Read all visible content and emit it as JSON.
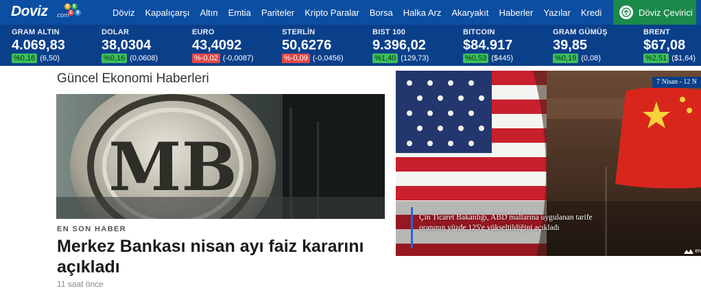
{
  "nav": {
    "logo": "Doviz",
    "logo_suffix": ".com",
    "items": [
      "Döviz",
      "Kapalıçarşı",
      "Altın",
      "Emtia",
      "Pariteler",
      "Kripto Paralar",
      "Borsa",
      "Halka Arz",
      "Akaryakıt",
      "Haberler",
      "Yazılar",
      "Kredi"
    ],
    "converter_label": "Döviz Çevirici"
  },
  "ticker": [
    {
      "name": "GRAM ALTIN",
      "value": "4.069,83",
      "pct": "%0,16",
      "abs": "(6,50)",
      "dir": "up"
    },
    {
      "name": "DOLAR",
      "value": "38,0304",
      "pct": "%0,16",
      "abs": "(0,0608)",
      "dir": "up"
    },
    {
      "name": "EURO",
      "value": "43,4092",
      "pct": "%-0,02",
      "abs": "(-0,0087)",
      "dir": "down"
    },
    {
      "name": "STERLİN",
      "value": "50,6276",
      "pct": "%-0,09",
      "abs": "(-0,0456)",
      "dir": "down"
    },
    {
      "name": "BIST 100",
      "value": "9.396,02",
      "pct": "%1,40",
      "abs": "(129,73)",
      "dir": "up"
    },
    {
      "name": "BITCOIN",
      "value": "$84.917",
      "pct": "%0,53",
      "abs": "($445)",
      "dir": "up"
    },
    {
      "name": "GRAM GÜMÜŞ",
      "value": "39,85",
      "pct": "%0,19",
      "abs": "(0,08)",
      "dir": "up"
    },
    {
      "name": "BRENT",
      "value": "$67,08",
      "pct": "%2,51",
      "abs": "($1,64)",
      "dir": "up"
    }
  ],
  "main": {
    "section_title": "Güncel Ekonomi Haberleri",
    "hero_logo_letters": "MB",
    "eyebrow": "EN SON HABER",
    "headline": "Merkez Bankası nisan ayı faiz kararını açıkladı",
    "timestamp": "11 saat önce"
  },
  "video": {
    "date_badge": "7 Nisan - 12 N",
    "caption": "Çin Ticaret Bakanlığı, ABD mallarına uygulanan tarife oranının yüzde 125'e yükseltildiğini açıkladı",
    "brand": "en"
  },
  "colors": {
    "nav_bg": "#0b4ea2",
    "ticker_bg": "#0a3f8a",
    "up": "#3bbf5d",
    "down": "#e04848",
    "converter_bg": "#1a8a4a"
  }
}
